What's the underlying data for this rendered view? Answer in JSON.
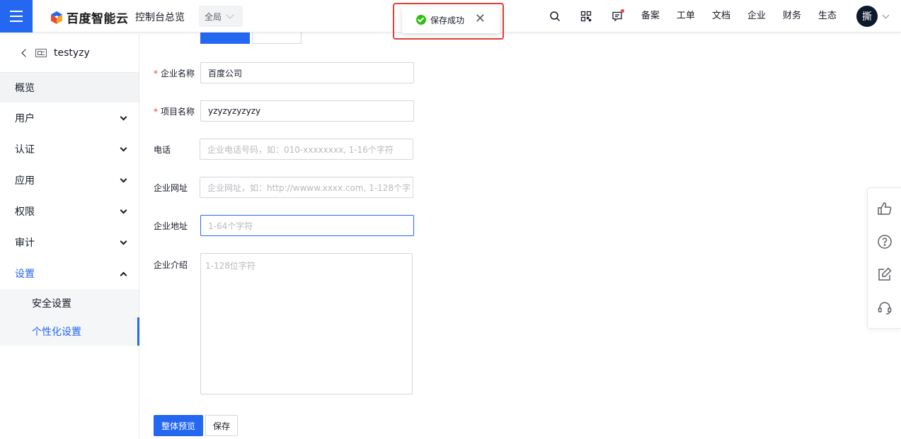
{
  "header": {
    "logo_text": "百度智能云",
    "console_title": "控制台总览",
    "scope": "全局",
    "nav": [
      "备案",
      "工单",
      "文档",
      "企业",
      "财务",
      "生态"
    ],
    "avatar_char": "撕"
  },
  "toast": {
    "message": "保存成功"
  },
  "sidebar": {
    "project": "testyzy",
    "items": [
      {
        "label": "概览"
      },
      {
        "label": "用户"
      },
      {
        "label": "认证"
      },
      {
        "label": "应用"
      },
      {
        "label": "权限"
      },
      {
        "label": "审计"
      },
      {
        "label": "设置"
      }
    ],
    "sub_items": [
      {
        "label": "安全设置"
      },
      {
        "label": "个性化设置"
      }
    ]
  },
  "form": {
    "company_name": {
      "label": "企业名称",
      "value": "百度公司"
    },
    "project_name": {
      "label": "项目名称",
      "value": "yzyzyzyzyzy"
    },
    "phone": {
      "label": "电话",
      "placeholder": "企业电话号码，如：010-xxxxxxxx, 1-16个字符"
    },
    "website": {
      "label": "企业网址",
      "placeholder": "企业网址，如：http://wwww.xxxx.com, 1-128个字"
    },
    "address": {
      "label": "企业地址",
      "placeholder": "1-64个字符"
    },
    "intro": {
      "label": "企业介绍",
      "placeholder": "1-128位字符"
    },
    "preview_button": "整体预览",
    "save_button": "保存"
  },
  "colors": {
    "accent": "#2468f2",
    "success": "#30bf13",
    "required": "#f33e3e"
  }
}
